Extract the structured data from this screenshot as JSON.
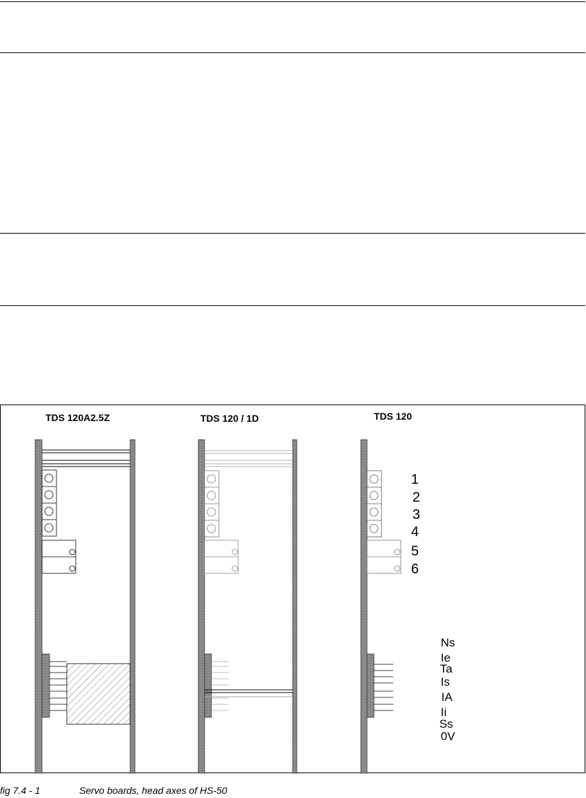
{
  "diagram": {
    "boards": [
      {
        "title": "TDS 120A2.5Z"
      },
      {
        "title": "TDS 120 / 1D"
      },
      {
        "title": "TDS 120"
      }
    ],
    "numbers": [
      "1",
      "2",
      "3",
      "4",
      "5",
      "6"
    ],
    "signals": [
      "Ns",
      "Ie",
      "Ta",
      "Is",
      "IA",
      "Ii",
      "Ss",
      "0V"
    ]
  },
  "caption": {
    "figure": "fig 7.4 - 1",
    "text": "Servo boards, head axes of HS-50"
  },
  "colors": {
    "rail": "#8c8c8c",
    "line": "#000000",
    "light_line": "#b0b0b0"
  }
}
